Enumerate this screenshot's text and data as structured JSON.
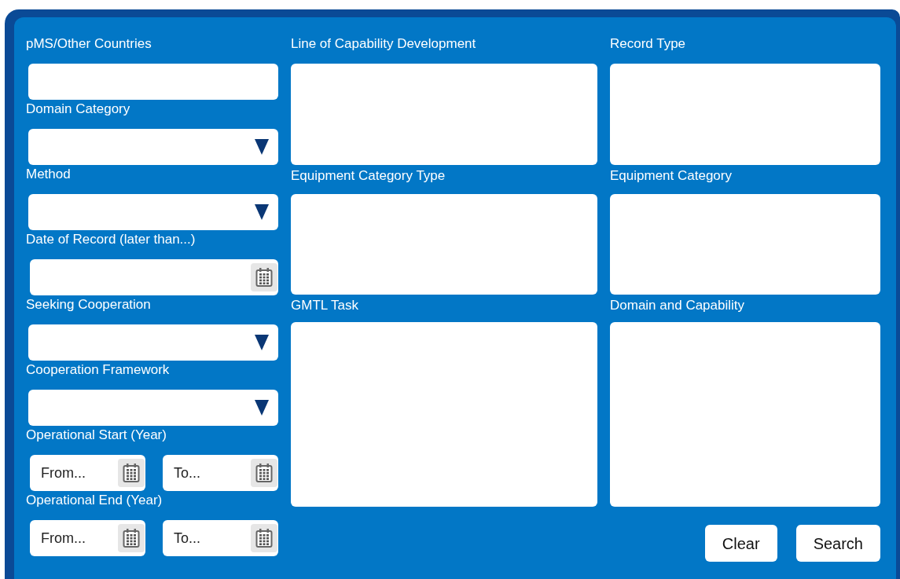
{
  "left_fields": [
    {
      "label": "pMS/Other Countries",
      "kind": "text"
    },
    {
      "label": "Domain Category",
      "kind": "select"
    },
    {
      "label": "Method",
      "kind": "select"
    },
    {
      "label": "Date of Record (later than...)",
      "kind": "date"
    },
    {
      "label": "Seeking Cooperation",
      "kind": "select"
    },
    {
      "label": "Cooperation Framework",
      "kind": "select"
    },
    {
      "label": "Operational Start (Year)",
      "kind": "range",
      "from_placeholder": "From...",
      "to_placeholder": "To..."
    },
    {
      "label": "Operational End (Year)",
      "kind": "range",
      "from_placeholder": "From...",
      "to_placeholder": "To..."
    }
  ],
  "middle_lists": [
    {
      "label": "Line of Capability Development"
    },
    {
      "label": "Equipment Category Type"
    },
    {
      "label": "GMTL Task"
    }
  ],
  "right_lists": [
    {
      "label": "Record Type"
    },
    {
      "label": "Equipment Category"
    },
    {
      "label": "Domain and Capability"
    }
  ],
  "buttons": [
    "Clear",
    "Search"
  ]
}
